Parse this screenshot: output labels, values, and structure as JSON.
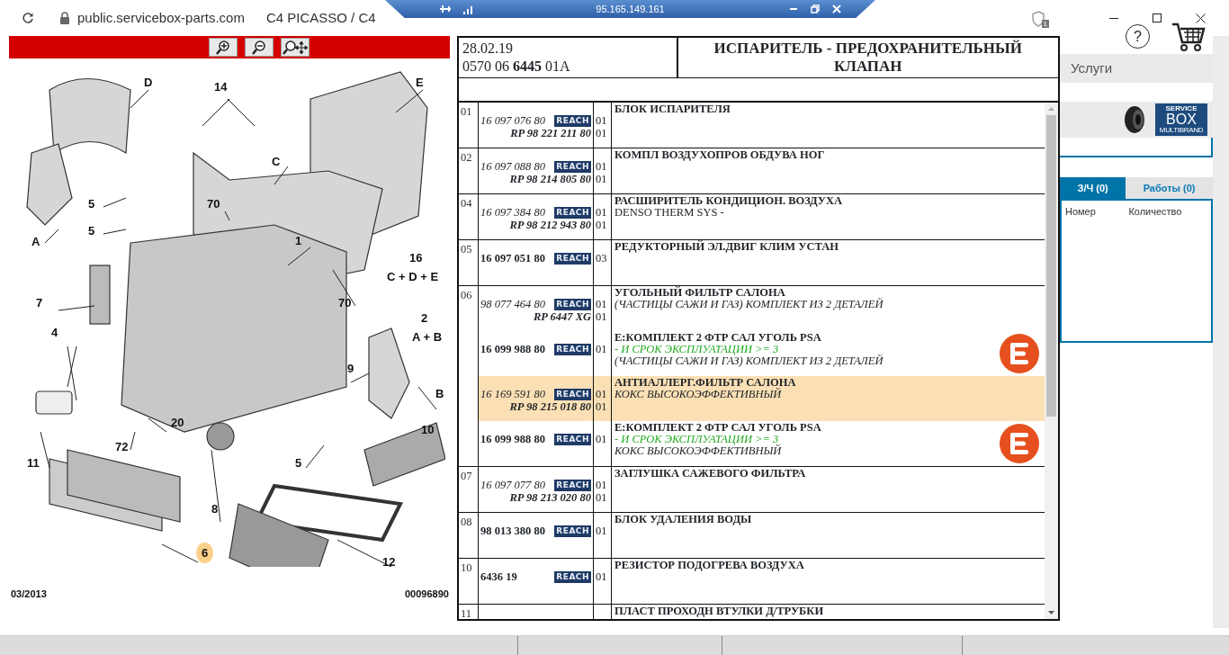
{
  "browser": {
    "url": "public.servicebox-parts.com",
    "title": "C4 PICASSO / C4",
    "remote_bar": {
      "address": "95.165.149.161"
    },
    "extension_badge": "1"
  },
  "diagram": {
    "callouts": [
      {
        "text": "D"
      },
      {
        "text": "14"
      },
      {
        "text": "E"
      },
      {
        "text": "C"
      },
      {
        "text": "5"
      },
      {
        "text": "70"
      },
      {
        "text": "5"
      },
      {
        "text": "A"
      },
      {
        "text": "1"
      },
      {
        "text": "16"
      },
      {
        "text": "C + D + E"
      },
      {
        "text": "7"
      },
      {
        "text": "70"
      },
      {
        "text": "2"
      },
      {
        "text": "A + B"
      },
      {
        "text": "4"
      },
      {
        "text": "9"
      },
      {
        "text": "B"
      },
      {
        "text": "20"
      },
      {
        "text": "72"
      },
      {
        "text": "10"
      },
      {
        "text": "11"
      },
      {
        "text": "5"
      },
      {
        "text": "8"
      },
      {
        "text": "6",
        "highlighted": true
      },
      {
        "text": "12"
      }
    ],
    "date": "03/2013",
    "drawing_number": "00096890"
  },
  "sheet": {
    "date": "28.02.19",
    "reference": "0570 06 **6445** 01A",
    "title": "ИСПАРИТЕЛЬ - ПРЕДОХРАНИТЕЛЬНЫЙ КЛАПАН"
  },
  "parts_rows": [
    {
      "num": "01",
      "entries": [
        {
          "part": "16 097 076 80",
          "kind": "regular",
          "reach": "REACH",
          "qty": "01",
          "rp": "RP 98 221 211 80",
          "rp_qty": "01",
          "title": "БЛОК ИСПАРИТЕЛЯ"
        }
      ]
    },
    {
      "num": "02",
      "entries": [
        {
          "part": "16 097 088 80",
          "kind": "regular",
          "reach": "REACH",
          "qty": "01",
          "rp": "RP 98 214 805 80",
          "rp_qty": "01",
          "title": "КОМПЛ ВОЗДУХОПРОВ ОБДУВА НОГ"
        }
      ]
    },
    {
      "num": "04",
      "entries": [
        {
          "part": "16 097 384 80",
          "kind": "regular",
          "reach": "REACH",
          "qty": "01",
          "rp": "RP 98 212 943 80",
          "rp_qty": "01",
          "title": "РАСШИРИТЕЛЬ КОНДИЦИОН. ВОЗДУХА",
          "lines": [
            {
              "text": "DENSO THERM SYS -",
              "kind": "plain"
            }
          ]
        }
      ]
    },
    {
      "num": "05",
      "entries": [
        {
          "part": "16 097 051 80",
          "kind": "featured",
          "reach": "REACH",
          "qty": "03",
          "title": "РЕДУКТОРНЫЙ ЭЛ.ДВИГ КЛИМ УСТАН"
        }
      ]
    },
    {
      "num": "06",
      "entries": [
        {
          "part": "98 077 464 80",
          "kind": "regular",
          "reach": "REACH",
          "qty": "01",
          "rp": "RP 6447 XG",
          "rp_qty": "01",
          "title": "УГОЛЬНЫЙ ФИЛЬТР САЛОНА",
          "lines": [
            {
              "text": "(ЧАСТИЦЫ САЖИ И ГАЗ) КОМПЛЕКТ ИЗ 2 ДЕТАЛЕЙ",
              "kind": "note"
            }
          ]
        },
        {
          "part": "16 099 988 80",
          "kind": "featured",
          "reach": "REACH",
          "qty": "01",
          "title": "Е:КОМПЛЕКТ 2 ФТР САЛ УГОЛЬ PSA",
          "lines": [
            {
              "text": "- И СРОК ЭКСПЛУАТАЦИИ >= 3",
              "kind": "condition"
            },
            {
              "text": "(ЧАСТИЦЫ САЖИ И ГАЗ) КОМПЛЕКТ ИЗ 2 ДЕТАЛЕЙ",
              "kind": "note"
            }
          ],
          "e_logo": true
        },
        {
          "part": "16 169 591 80",
          "kind": "regular",
          "reach": "REACH",
          "qty": "01",
          "rp": "RP 98 215 018 80",
          "rp_qty": "01",
          "title": "АНТИАЛЛЕРГ.ФИЛЬТР САЛОНА",
          "lines": [
            {
              "text": "КОКС ВЫСОКОЭФФЕКТИВНЫЙ",
              "kind": "note"
            }
          ],
          "highlighted": true
        },
        {
          "part": "16 099 988 80",
          "kind": "featured",
          "reach": "REACH",
          "qty": "01",
          "title": "Е:КОМПЛЕКТ 2 ФТР САЛ УГОЛЬ PSA",
          "lines": [
            {
              "text": "- И СРОК ЭКСПЛУАТАЦИИ >= 3",
              "kind": "condition"
            },
            {
              "text": "КОКС ВЫСОКОЭФФЕКТИВНЫЙ",
              "kind": "note"
            }
          ],
          "e_logo": true
        }
      ]
    },
    {
      "num": "07",
      "entries": [
        {
          "part": "16 097 077 80",
          "kind": "regular",
          "reach": "REACH",
          "qty": "01",
          "rp": "RP 98 213 020 80",
          "rp_qty": "01",
          "title": "ЗАГЛУШКА САЖЕВОГО ФИЛЬТРА"
        }
      ]
    },
    {
      "num": "08",
      "entries": [
        {
          "part": "98 013 380 80",
          "kind": "featured",
          "reach": "REACH",
          "qty": "01",
          "title": "БЛОК УДАЛЕНИЯ ВОДЫ"
        }
      ]
    },
    {
      "num": "10",
      "entries": [
        {
          "part": "6436 19",
          "kind": "featured",
          "reach": "REACH",
          "qty": "01",
          "title": "РЕЗИСТОР ПОДОГРЕВА ВОЗДУХА"
        }
      ]
    },
    {
      "num": "11",
      "entries": [
        {
          "title": "ПЛАСТ ПРОХОДН ВТУЛКИ Д/ТРУБКИ"
        }
      ]
    }
  ],
  "side_panel": {
    "help": "?",
    "services": "Услуги",
    "logo": {
      "line1": "SERVICE",
      "line2": "BOX",
      "line3": "MULTIBRAND"
    },
    "tabs": [
      {
        "label": "З/Ч (0)",
        "selected": true
      },
      {
        "label": "Работы (0)",
        "selected": false
      }
    ],
    "columns": [
      "Номер",
      "Количество"
    ]
  }
}
